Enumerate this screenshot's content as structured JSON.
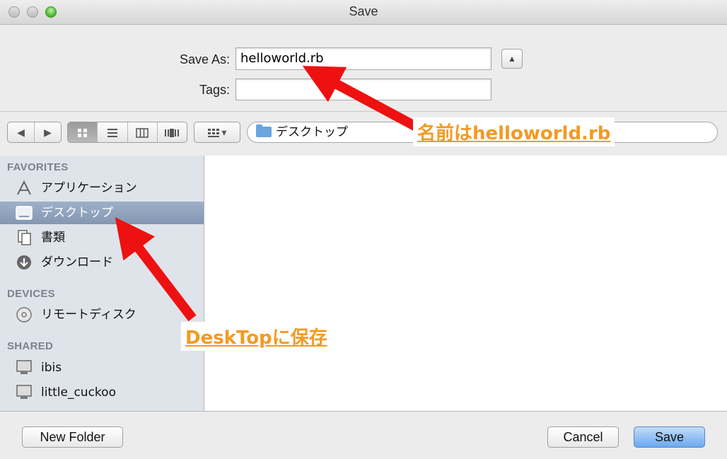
{
  "window": {
    "title": "Save"
  },
  "form": {
    "save_as_label": "Save As:",
    "save_as_value": "helloworld.rb",
    "tags_label": "Tags:",
    "tags_value": ""
  },
  "toolbar": {
    "back_glyph": "◀",
    "forward_glyph": "▶",
    "view_modes": [
      "icon",
      "list",
      "column",
      "cover-flow"
    ],
    "active_view": "icon",
    "arrange_glyph": "▾",
    "location": "デスクトップ"
  },
  "sidebar": {
    "favorites_header": "FAVORITES",
    "favorites": [
      {
        "label": "アプリケーション",
        "icon": "applications-icon"
      },
      {
        "label": "デスクトップ",
        "icon": "desktop-icon",
        "selected": true
      },
      {
        "label": "書類",
        "icon": "documents-icon"
      },
      {
        "label": "ダウンロード",
        "icon": "downloads-icon"
      }
    ],
    "devices_header": "DEVICES",
    "devices": [
      {
        "label": "リモートディスク",
        "icon": "disc-icon"
      }
    ],
    "shared_header": "SHARED",
    "shared": [
      {
        "label": "ibis",
        "icon": "computer-icon"
      },
      {
        "label": "little_cuckoo",
        "icon": "computer-icon"
      }
    ]
  },
  "buttons": {
    "new_folder": "New Folder",
    "cancel": "Cancel",
    "save": "Save"
  },
  "annotations": {
    "filename_note": "名前はhelloworld.rb",
    "desktop_note": "DeskTopに保存",
    "color": "#f39a22",
    "arrow_color": "#ee1111"
  }
}
